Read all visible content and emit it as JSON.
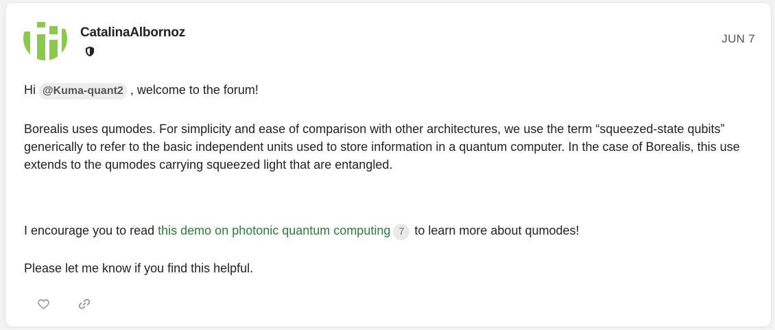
{
  "post": {
    "username": "CatalinaAlbornoz",
    "date": "JUN 7",
    "greeting_before": "Hi ",
    "mention": "@Kuma-quant2",
    "greeting_after": " , welcome to the forum!",
    "paragraph2": "Borealis uses qumodes. For simplicity and ease of comparison with other architectures, we use the term “squeezed-state qubits” generically to refer to the basic independent units used to store information in a quantum computer. In the case of Borealis, this use extends to the qumodes carrying squeezed light that are entangled.",
    "p3_before": "I encourage you to read ",
    "link_text": "this demo on photonic quantum computing",
    "link_clicks": "7",
    "p3_after": " to learn more about qumodes!",
    "paragraph4": "Please let me know if you find this helpful."
  },
  "icons": {
    "badge": "shield-icon",
    "like": "heart-icon",
    "share": "link-icon"
  },
  "colors": {
    "link": "#2e7a3a",
    "avatar_green": "#8cc850",
    "avatar_bg": "#e7efdc"
  }
}
